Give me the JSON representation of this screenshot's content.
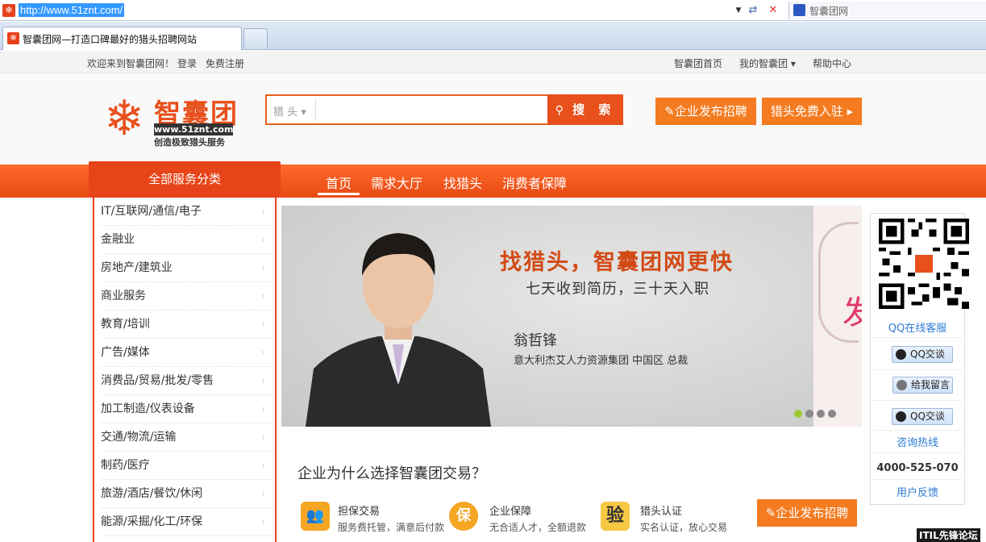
{
  "browser": {
    "url": "http://www.51znt.com/",
    "tab_title": "智囊团网—打造口碑最好的猎头招聘网站",
    "search_provider": "智囊团网"
  },
  "topbar": {
    "welcome": "欢迎来到智囊团网！",
    "login": "登录",
    "register": "免费注册",
    "home": "智囊团首页",
    "my": "我的智囊团 ▾",
    "help": "帮助中心"
  },
  "header": {
    "logo_text": "智囊团",
    "logo_url": "www.51znt.com",
    "logo_slogan": "创造极致猎头服务",
    "search_type": "猎 头 ▾",
    "search_placeholder": "",
    "search_button": "搜 索",
    "post_job_button": "✎企业发布招聘",
    "hunter_join_button": "猎头免费入驻 ▸"
  },
  "nav": {
    "category_title": "全部服务分类",
    "links": [
      "首页",
      "需求大厅",
      "找猎头",
      "消费者保障"
    ]
  },
  "categories": [
    "IT/互联网/通信/电子",
    "金融业",
    "房地产/建筑业",
    "商业服务",
    "教育/培训",
    "广告/媒体",
    "消费品/贸易/批发/零售",
    "加工制造/仪表设备",
    "交通/物流/运输",
    "制药/医疗",
    "旅游/酒店/餐饮/休闲",
    "能源/采掘/化工/环保"
  ],
  "banner": {
    "headline": "找猎头，智囊团网更快",
    "subline": "七天收到简历，三十天入职",
    "person_name": "翁哲锋",
    "person_title": "意大利杰艾人力资源集团 中国区 总裁",
    "active_dot_color": "#9acd32"
  },
  "why": {
    "title": "企业为什么选择智囊团交易？",
    "features": [
      {
        "icon": "handshake-icon",
        "title": "担保交易",
        "desc": "服务费托管，满意后付款"
      },
      {
        "icon": "shield-icon",
        "glyph": "保",
        "title": "企业保障",
        "desc": "无合适人才，全额退款"
      },
      {
        "icon": "verify-icon",
        "glyph": "验",
        "title": "猎头认证",
        "desc": "实名认证，放心交易"
      }
    ],
    "post_button": "✎企业发布招聘"
  },
  "sidebar": {
    "qq_service": "QQ在线客服",
    "qq_chat_1": "QQ交谈",
    "leave_msg": "给我留言",
    "qq_chat_2": "QQ交谈",
    "hotline_label": "咨询热线",
    "hotline_number": "4000-525-070",
    "feedback": "用户反馈"
  },
  "watermark": "ITIL先锋论坛",
  "colors": {
    "brand_orange": "#e8501c",
    "button_orange": "#f47b20",
    "link_blue": "#2d7bd1"
  }
}
